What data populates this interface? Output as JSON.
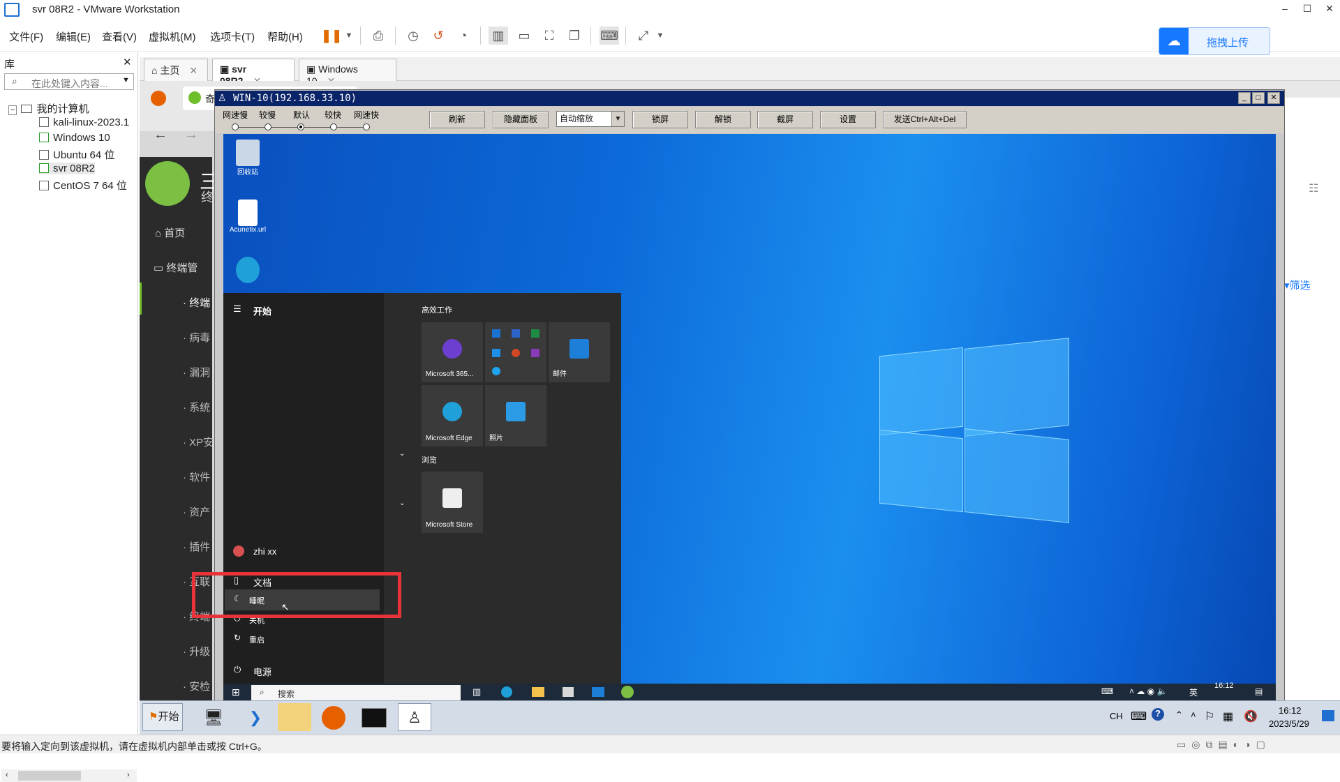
{
  "window": {
    "title": "svr 08R2 - VMware Workstation",
    "minimize": "–",
    "maximize": "☐",
    "close": "✕"
  },
  "menu": [
    "文件(F)",
    "编辑(E)",
    "查看(V)",
    "虚拟机(M)",
    "选项卡(T)",
    "帮助(H)"
  ],
  "upload": {
    "label": "拖拽上传",
    "icon": "cloud-upload-icon"
  },
  "library": {
    "title": "库",
    "close": "✕",
    "search_placeholder": "在此处键入内容...",
    "root": "我的计算机",
    "items": [
      "kali-linux-2023.1",
      "Windows 10",
      "Ubuntu 64 位",
      "svr 08R2",
      "CentOS 7 64 位"
    ]
  },
  "tabs": [
    {
      "label": "主页",
      "close": "✕"
    },
    {
      "label": "svr 08R2",
      "close": "✕"
    },
    {
      "label": "Windows 10",
      "close": "✕"
    }
  ],
  "host_browser": {
    "tab_fragment": "奇",
    "sidebar": {
      "logo_char": "三",
      "logo_char2": "终",
      "home": "首页",
      "terminal_mgmt": "终端管",
      "sub_items": [
        "终端",
        "病毒",
        "漏洞",
        "系统",
        "XP安",
        "软件",
        "资产",
        "插件",
        "互联",
        "终端",
        "升级",
        "安检"
      ]
    },
    "filter": "筛选"
  },
  "rdp": {
    "title": "WIN-10(192.168.33.10)",
    "speeds": [
      "网速慢",
      "较慢",
      "默认",
      "较快",
      "网速快"
    ],
    "selected_speed": 2,
    "buttons": [
      "刷新",
      "隐藏面板",
      "锁屏",
      "解锁",
      "截屏",
      "设置",
      "发送Ctrl+Alt+Del"
    ],
    "zoom": "自动缩放"
  },
  "desktop": {
    "icons": [
      "回收站",
      "Acunetix.url",
      ""
    ],
    "start_menu": {
      "header": "开始",
      "section1": "高效工作",
      "section2": "浏览",
      "tiles": [
        "Microsoft 365...",
        "",
        "邮件",
        "Microsoft Edge",
        "照片",
        "Microsoft Store"
      ],
      "user": "zhi xx",
      "documents": "文档",
      "sleep": "睡眠",
      "shutdown": "关机",
      "restart": "重启",
      "power": "电源"
    },
    "taskbar": {
      "search": "搜索",
      "time": "16:12",
      "lang": "英"
    }
  },
  "host_taskbar": {
    "start": "开始",
    "lang": "CH",
    "time": "16:12",
    "date": "2023/5/29"
  },
  "statusbar": {
    "message": "要将输入定向到该虚拟机，请在虚拟机内部单击或按 Ctrl+G。"
  }
}
